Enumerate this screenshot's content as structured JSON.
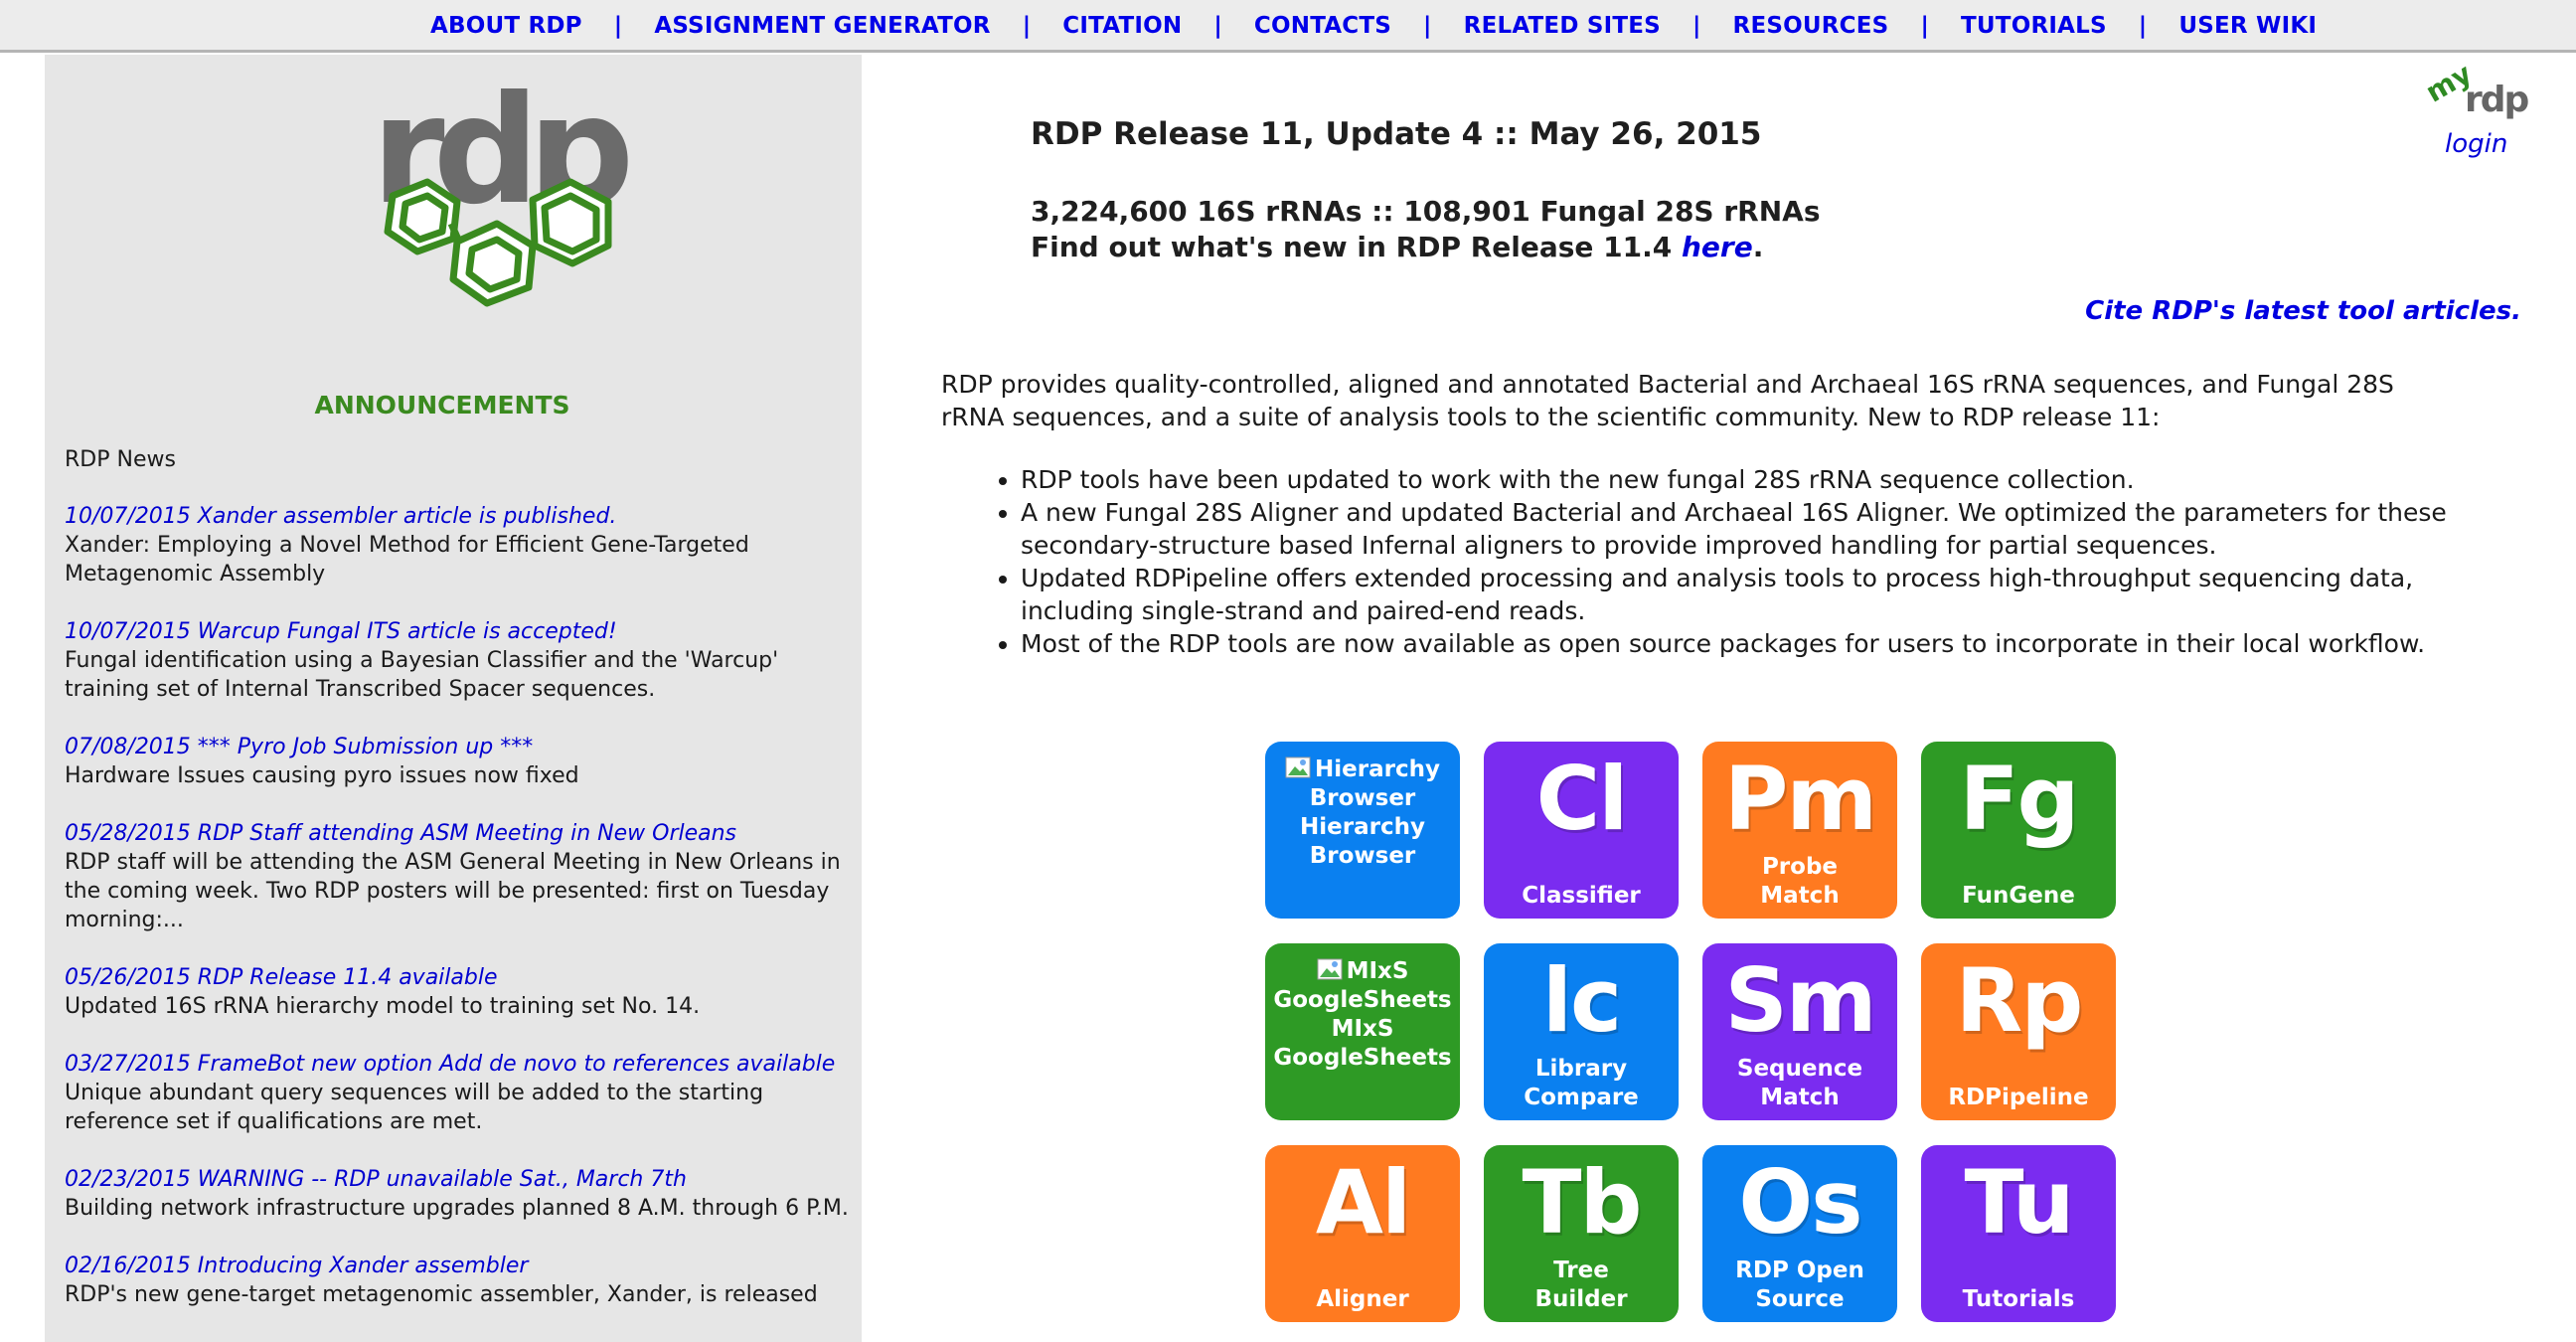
{
  "nav": {
    "items": [
      {
        "label": "ABOUT RDP"
      },
      {
        "label": "ASSIGNMENT GENERATOR"
      },
      {
        "label": "CITATION"
      },
      {
        "label": "CONTACTS"
      },
      {
        "label": "RELATED SITES"
      },
      {
        "label": "RESOURCES"
      },
      {
        "label": "TUTORIALS"
      },
      {
        "label": "USER WIKI"
      }
    ],
    "separator": "|",
    "link_color": "#0000e8"
  },
  "logo": {
    "text": "rdp",
    "icon": "rdp-logo-hexagons"
  },
  "sidebar": {
    "announcements_title": "ANNOUNCEMENTS",
    "news_header": "RDP News",
    "news": [
      {
        "link": "10/07/2015  Xander assembler article is published.",
        "desc": "Xander: Employing a Novel Method for Efficient Gene-Targeted Metagenomic Assembly"
      },
      {
        "link": "10/07/2015  Warcup Fungal ITS article is accepted!",
        "desc": "Fungal identification using a Bayesian Classifier and the 'Warcup' training set of Internal Transcribed Spacer sequences."
      },
      {
        "link": "07/08/2015  *** Pyro Job Submission up ***",
        "desc": "Hardware Issues causing pyro issues now fixed"
      },
      {
        "link": "05/28/2015  RDP Staff attending ASM Meeting in New Orleans",
        "desc": "RDP staff will be attending the ASM General Meeting in New Orleans in the coming week. Two RDP posters will be presented: first on Tuesday morning:..."
      },
      {
        "link": "05/26/2015  RDP Release 11.4 available",
        "desc": "Updated 16S rRNA hierarchy model to training set No. 14."
      },
      {
        "link": "03/27/2015  FrameBot new option Add de novo to references available",
        "desc": "Unique abundant query sequences will be added to the starting reference set if qualifications are met."
      },
      {
        "link": "02/23/2015  WARNING -- RDP unavailable Sat., March 7th",
        "desc": "Building network infrastructure upgrades planned 8 A.M. through 6 P.M."
      },
      {
        "link": "02/16/2015  Introducing Xander assembler",
        "desc": "RDP's new gene-target metagenomic assembler, Xander, is released"
      }
    ]
  },
  "main": {
    "release_title": "RDP Release 11, Update 4 :: May 26, 2015",
    "stats": "3,224,600 16S rRNAs :: 108,901 Fungal 28S rRNAs",
    "whatsnew_prefix": "Find out what's new in RDP Release 11.4 ",
    "whatsnew_link": "here",
    "whatsnew_suffix": ".",
    "cite_link": "Cite RDP's latest tool articles.",
    "intro": "RDP provides quality-controlled, aligned and annotated Bacterial and Archaeal 16S rRNA sequences, and Fungal 28S rRNA sequences, and a suite of analysis tools to the scientific community. New to RDP release 11:",
    "features": [
      "RDP tools have been updated to work with the new fungal 28S rRNA sequence collection.",
      "A new Fungal 28S Aligner and updated Bacterial and Archaeal 16S Aligner. We optimized the parameters for these secondary-structure based Infernal aligners to provide improved handling for partial sequences.",
      "Updated RDPipeline offers extended processing and analysis tools to process high-throughput sequencing data, including single-strand and paired-end reads.",
      "Most of the RDP tools are now available as open source packages for users to incorporate in their local workflow."
    ]
  },
  "myrdp": {
    "logo_text_my": "my",
    "logo_text_rdp": "rdp",
    "login": "login"
  },
  "tools": [
    {
      "broken": true,
      "alt": "Hierarchy Browser",
      "label": "Hierarchy Browser",
      "color": "#0a80f0"
    },
    {
      "abbr": "Cl",
      "label": "Classifier",
      "color": "#7a2cf0"
    },
    {
      "abbr": "Pm",
      "label": "Probe Match",
      "color": "#ff7a20"
    },
    {
      "abbr": "Fg",
      "label": "FunGene",
      "color": "#2e9a25"
    },
    {
      "broken": true,
      "alt": "MIxS GoogleSheets",
      "label": "MIxS GoogleSheets",
      "color": "#2e9a25"
    },
    {
      "abbr": "lc",
      "label": "Library Compare",
      "color": "#0a80f0"
    },
    {
      "abbr": "Sm",
      "label": "Sequence Match",
      "color": "#7a2cf0"
    },
    {
      "abbr": "Rp",
      "label": "RDPipeline",
      "color": "#ff7a20"
    },
    {
      "abbr": "Al",
      "label": "Aligner",
      "color": "#ff7a20"
    },
    {
      "abbr": "Tb",
      "label": "Tree Builder",
      "color": "#2e9a25"
    },
    {
      "abbr": "Os",
      "label": "RDP Open Source",
      "color": "#0a80f0"
    },
    {
      "abbr": "Tu",
      "label": "Tutorials",
      "color": "#7a2cf0"
    }
  ]
}
